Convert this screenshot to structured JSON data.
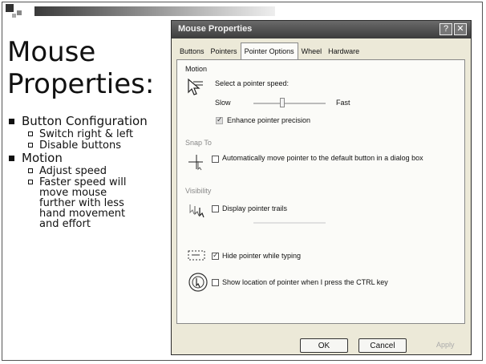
{
  "slide": {
    "title": "Mouse Properties:",
    "bullets": [
      {
        "text": "Button Configuration",
        "subs": [
          "Switch right & left",
          "Disable buttons"
        ]
      },
      {
        "text": "Motion",
        "subs": [
          "Adjust speed",
          "Faster speed will move mouse further with less hand movement and effort"
        ]
      }
    ]
  },
  "dialog": {
    "title": "Mouse Properties",
    "help_glyph": "?",
    "close_glyph": "✕",
    "tabs": [
      "Buttons",
      "Pointers",
      "Pointer Options",
      "Wheel",
      "Hardware"
    ],
    "active_tab": "Pointer Options",
    "motion": {
      "group": "Motion",
      "prompt": "Select a pointer speed:",
      "slow": "Slow",
      "fast": "Fast",
      "speed_fraction": 0.4,
      "precision_label": "Enhance pointer precision",
      "precision_checked": true
    },
    "snap": {
      "group": "Snap To",
      "label": "Automatically move pointer to the default button in a dialog box",
      "checked": false
    },
    "visibility": {
      "group": "Visibility",
      "trails_label": "Display pointer trails",
      "trails_checked": false,
      "hide_label": "Hide pointer while typing",
      "hide_checked": true,
      "ctrl_label": "Show location of pointer when I press the CTRL key",
      "ctrl_checked": false
    },
    "buttons": {
      "ok": "OK",
      "cancel": "Cancel",
      "apply": "Apply"
    }
  }
}
